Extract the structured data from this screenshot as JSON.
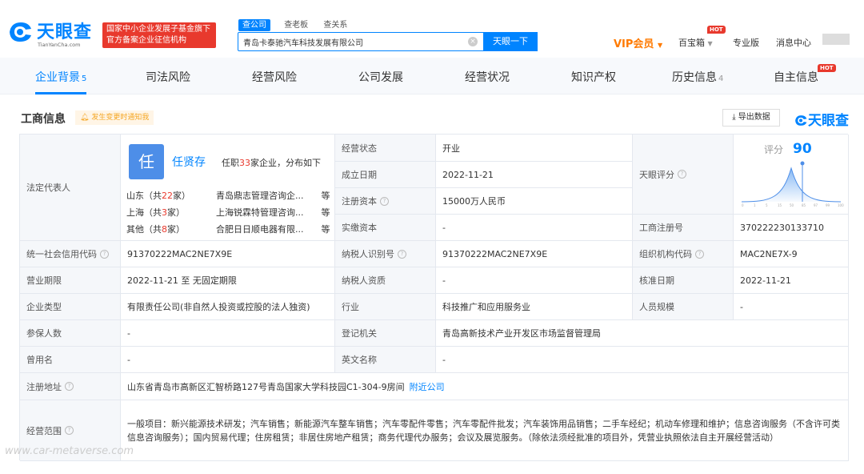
{
  "header": {
    "logo_title": "天眼查",
    "logo_sub": "TianYanCha.com",
    "badge_line1": "国家中小企业发展子基金旗下",
    "badge_line2": "官方备案企业征信机构",
    "search_tabs": [
      "查公司",
      "查老板",
      "查关系"
    ],
    "search_value": "青岛卡泰驰汽车科技发展有限公司",
    "search_button": "天眼一下",
    "vip": "VIP会员",
    "baibao": "百宝箱",
    "hot": "HOT",
    "pro": "专业版",
    "messages": "消息中心"
  },
  "nav": {
    "items": [
      {
        "label": "企业背景",
        "count": "5"
      },
      {
        "label": "司法风险",
        "count": ""
      },
      {
        "label": "经营风险",
        "count": ""
      },
      {
        "label": "公司发展",
        "count": ""
      },
      {
        "label": "经营状况",
        "count": ""
      },
      {
        "label": "知识产权",
        "count": ""
      },
      {
        "label": "历史信息",
        "count": "4"
      },
      {
        "label": "自主信息",
        "count": ""
      }
    ],
    "hot": "HOT"
  },
  "section": {
    "title": "工商信息",
    "notify": "发生变更时通知我",
    "export": "导出数据",
    "brand": "天眼查"
  },
  "legal_rep": {
    "label": "法定代表人",
    "avatar_char": "任",
    "name": "任贤存",
    "info_prefix": "任职",
    "info_count": "33",
    "info_suffix": "家企业，分布如下",
    "regions": [
      {
        "region_pre": "山东（共",
        "count": "22",
        "region_post": "家）",
        "company": "青岛鼎志管理咨询企...",
        "more": "等"
      },
      {
        "region_pre": "上海（共",
        "count": "3",
        "region_post": "家）",
        "company": "上海锐霖特管理咨询...",
        "more": "等"
      },
      {
        "region_pre": "其他（共",
        "count": "8",
        "region_post": "家）",
        "company": "合肥日日顺电器有限...",
        "more": "等"
      }
    ]
  },
  "fields": {
    "status_label": "经营状态",
    "status": "开业",
    "est_label": "成立日期",
    "est": "2022-11-21",
    "capital_label": "注册资本",
    "capital": "15000万人民币",
    "paid_label": "实缴资本",
    "paid": "-",
    "score_label": "天眼评分",
    "score_word": "评分",
    "score": "90",
    "regno_label": "工商注册号",
    "regno": "370222230133710",
    "credit_label": "统一社会信用代码",
    "credit": "91370222MAC2NE7X9E",
    "taxid_label": "纳税人识别号",
    "taxid": "91370222MAC2NE7X9E",
    "org_label": "组织机构代码",
    "org": "MAC2NE7X-9",
    "term_label": "营业期限",
    "term": "2022-11-21 至 无固定期限",
    "taxq_label": "纳税人资质",
    "taxq": "-",
    "approve_label": "核准日期",
    "approve": "2022-11-21",
    "type_label": "企业类型",
    "type": "有限责任公司(非自然人投资或控股的法人独资)",
    "industry_label": "行业",
    "industry": "科技推广和应用服务业",
    "staff_label": "人员规模",
    "staff": "-",
    "insured_label": "参保人数",
    "insured": "-",
    "authority_label": "登记机关",
    "authority": "青岛高新技术产业开发区市场监督管理局",
    "former_label": "曾用名",
    "former": "-",
    "english_label": "英文名称",
    "english": "-",
    "address_label": "注册地址",
    "address": "山东省青岛市高新区汇智桥路127号青岛国家大学科技园C1-304-9房间",
    "nearby": "附近公司",
    "scope_label": "经营范围",
    "scope": "一般项目：新兴能源技术研发；汽车销售；新能源汽车整车销售；汽车零配件零售；汽车零配件批发；汽车装饰用品销售；二手车经纪；机动车修理和维护；信息咨询服务（不含许可类信息咨询服务）；国内贸易代理；住房租赁；非居住房地产租赁；商务代理代办服务；会议及展览服务。（除依法须经批准的项目外，凭营业执照依法自主开展经营活动）"
  },
  "chart_ticks": [
    "0",
    "1",
    "5",
    "15",
    "50",
    "85",
    "97",
    "99",
    "100"
  ],
  "watermark": "www.car-metaverse.com"
}
